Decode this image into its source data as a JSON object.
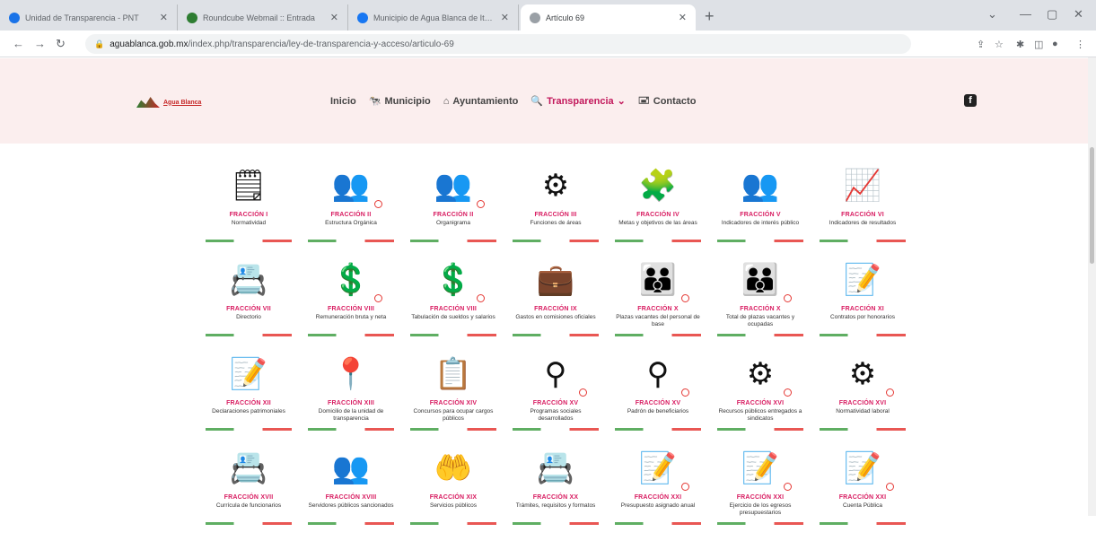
{
  "browser": {
    "tabs": [
      {
        "title": "Unidad de Transparencia - PNT",
        "color": "#1a73e8"
      },
      {
        "title": "Roundcube Webmail :: Entrada",
        "color": "#2e7d32"
      },
      {
        "title": "Municipio de Agua Blanca de Itu...",
        "color": "#1877f2"
      },
      {
        "title": "Artículo 69",
        "color": "#5f6368"
      }
    ],
    "url_host": "aguablanca.gob.mx",
    "url_path": "/index.php/transparencia/ley-de-transparencia-y-acceso/articulo-69"
  },
  "header": {
    "logo_text": "Agua Blanca",
    "menu": [
      {
        "label": "Inicio",
        "icon": ""
      },
      {
        "label": "Municipio",
        "icon": "🐄"
      },
      {
        "label": "Ayuntamiento",
        "icon": "⌂"
      },
      {
        "label": "Transparencia",
        "icon": "🔍",
        "caret": "⌄"
      },
      {
        "label": "Contacto",
        "icon": "🖃"
      }
    ],
    "social": "f"
  },
  "items": [
    {
      "fraccion": "FRACCIÓN I",
      "desc": "Normatividad",
      "icon": "🗒",
      "badge": false
    },
    {
      "fraccion": "FRACCIÓN II",
      "desc": "Estructura Orgánica",
      "icon": "👥",
      "badge": true
    },
    {
      "fraccion": "FRACCIÓN II",
      "desc": "Organigrama",
      "icon": "👥",
      "badge": true
    },
    {
      "fraccion": "FRACCIÓN III",
      "desc": "Funciones de áreas",
      "icon": "⚙",
      "badge": false
    },
    {
      "fraccion": "FRACCIÓN IV",
      "desc": "Metas y objetivos de las áreas",
      "icon": "🧩",
      "badge": false
    },
    {
      "fraccion": "FRACCIÓN V",
      "desc": "Indicadores de interés público",
      "icon": "👥",
      "badge": false
    },
    {
      "fraccion": "FRACCIÓN VI",
      "desc": "Indicadores de resultados",
      "icon": "📈",
      "badge": false
    },
    {
      "fraccion": "FRACCIÓN VII",
      "desc": "Directorio",
      "icon": "📇",
      "badge": false
    },
    {
      "fraccion": "FRACCIÓN VIII",
      "desc": "Remuneración bruta y neta",
      "icon": "💲",
      "badge": true
    },
    {
      "fraccion": "FRACCIÓN VIII",
      "desc": "Tabulación de sueldos y salarios",
      "icon": "💲",
      "badge": true
    },
    {
      "fraccion": "FRACCIÓN IX",
      "desc": "Gastos en comisiones oficiales",
      "icon": "💼",
      "badge": false
    },
    {
      "fraccion": "FRACCIÓN X",
      "desc": "Plazas vacantes del personal de base",
      "icon": "👪",
      "badge": true
    },
    {
      "fraccion": "FRACCIÓN X",
      "desc": "Total de plazas vacantes y ocupadas",
      "icon": "👪",
      "badge": true
    },
    {
      "fraccion": "FRACCIÓN XI",
      "desc": "Contratos por honorarios",
      "icon": "📝",
      "badge": false
    },
    {
      "fraccion": "FRACCIÓN XII",
      "desc": "Declaraciones patrimoniales",
      "icon": "📝",
      "badge": false
    },
    {
      "fraccion": "FRACCIÓN XIII",
      "desc": "Domicilio de la unidad de transparencia",
      "icon": "📍",
      "badge": false
    },
    {
      "fraccion": "FRACCIÓN XIV",
      "desc": "Concursos para ocupar cargos públicos",
      "icon": "📋",
      "badge": false
    },
    {
      "fraccion": "FRACCIÓN XV",
      "desc": "Programas sociales desarrollados",
      "icon": "⚲",
      "badge": true
    },
    {
      "fraccion": "FRACCIÓN XV",
      "desc": "Padrón de beneficiarios",
      "icon": "⚲",
      "badge": true
    },
    {
      "fraccion": "FRACCIÓN XVI",
      "desc": "Recursos públicos entregados a sindicatos",
      "icon": "⚙",
      "badge": true
    },
    {
      "fraccion": "FRACCIÓN XVI",
      "desc": "Normatividad laboral",
      "icon": "⚙",
      "badge": true
    },
    {
      "fraccion": "FRACCIÓN XVII",
      "desc": "Currícula de funcionarios",
      "icon": "📇",
      "badge": false
    },
    {
      "fraccion": "FRACCIÓN XVIII",
      "desc": "Servidores públicos sancionados",
      "icon": "👥",
      "badge": false
    },
    {
      "fraccion": "FRACCIÓN XIX",
      "desc": "Servicios públicos",
      "icon": "🤲",
      "badge": false
    },
    {
      "fraccion": "FRACCIÓN XX",
      "desc": "Trámites, requisitos y formatos",
      "icon": "📇",
      "badge": false
    },
    {
      "fraccion": "FRACCIÓN XXI",
      "desc": "Presupuesto asignado anual",
      "icon": "📝",
      "badge": true
    },
    {
      "fraccion": "FRACCIÓN XXI",
      "desc": "Ejercicio de los egresos presupuestarios",
      "icon": "📝",
      "badge": true
    },
    {
      "fraccion": "FRACCIÓN XXI",
      "desc": "Cuenta Pública",
      "icon": "📝",
      "badge": true
    }
  ]
}
